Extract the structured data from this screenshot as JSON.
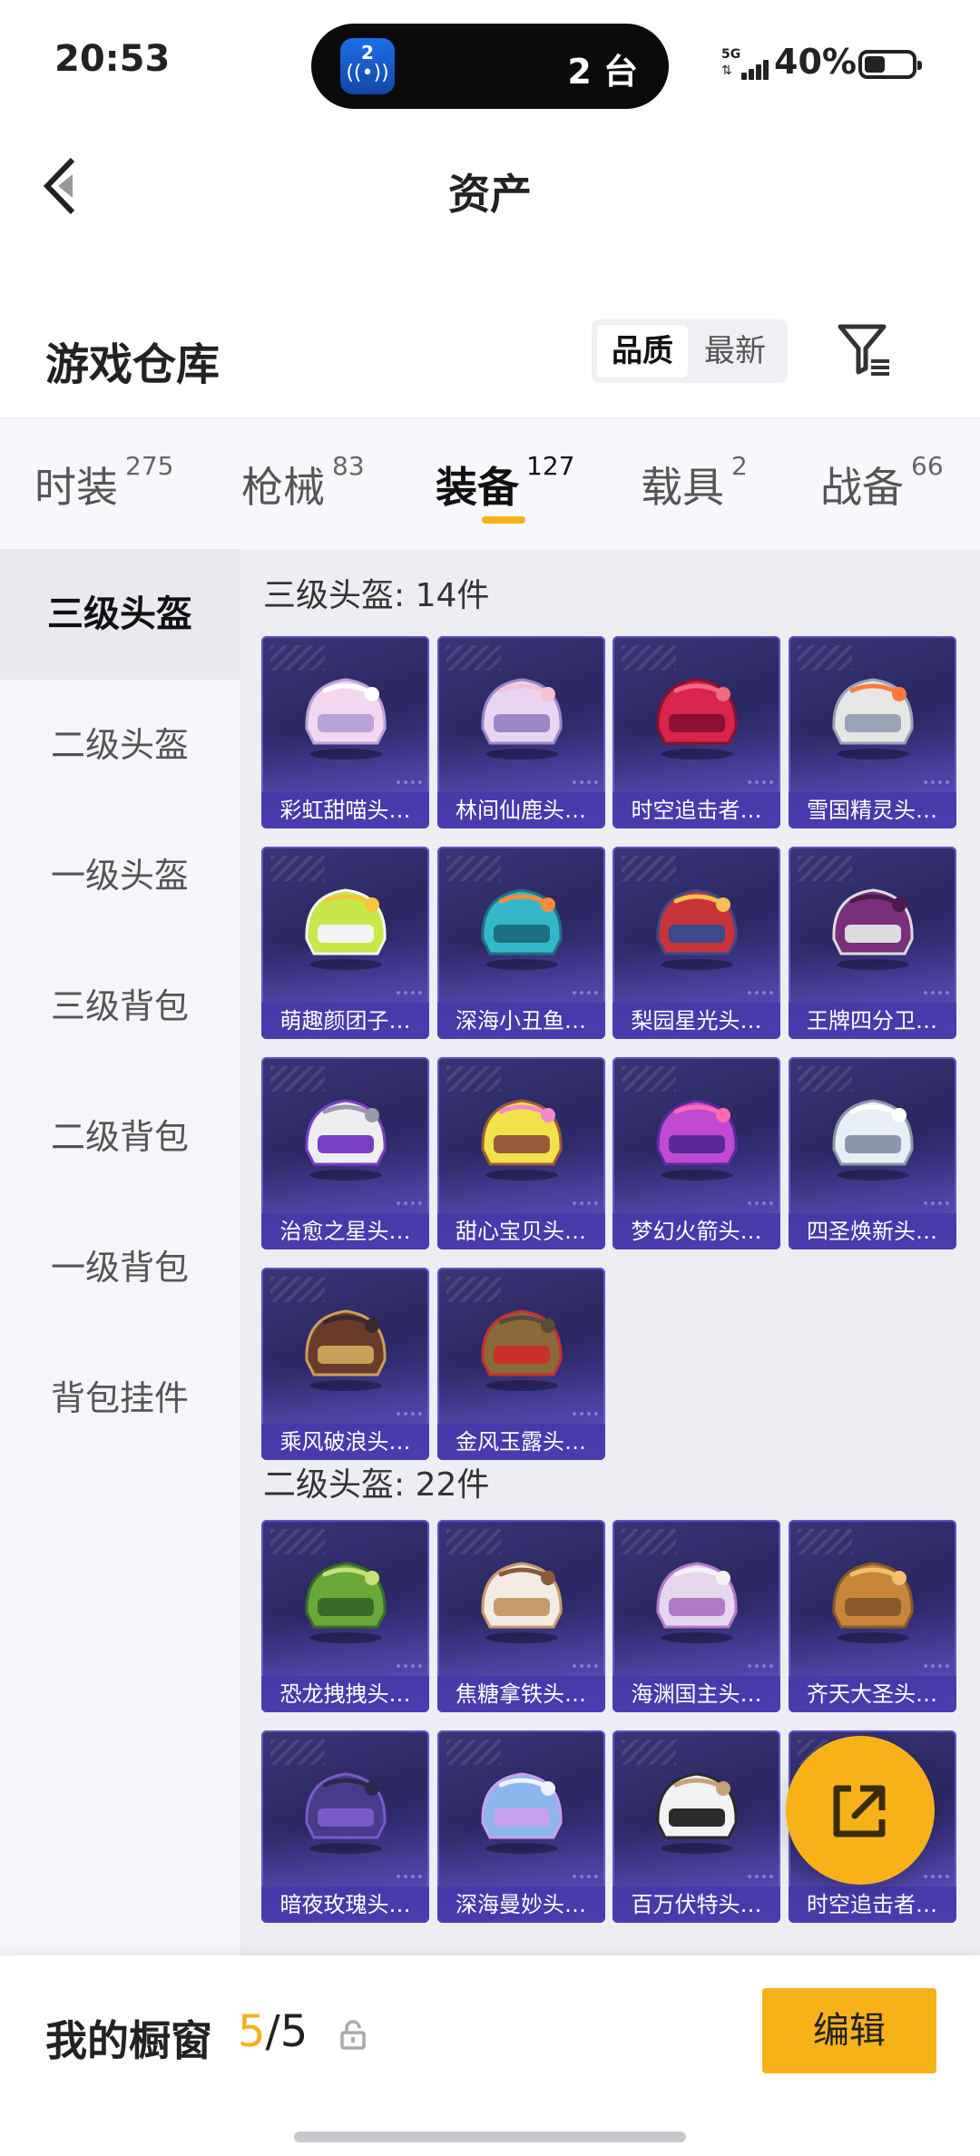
{
  "status_bar": {
    "time": "20:53",
    "island_icon_number": "2",
    "island_icon_glyph": "((•))",
    "island_text": "2 台",
    "network": "5G",
    "battery": "40%"
  },
  "header": {
    "title": "资产"
  },
  "warehouse": {
    "title": "游戏仓库",
    "sort_options": [
      "品质",
      "最新"
    ],
    "sort_active": "品质"
  },
  "tabs": [
    {
      "label": "时装",
      "count": "275"
    },
    {
      "label": "枪械",
      "count": "83"
    },
    {
      "label": "装备",
      "count": "127"
    },
    {
      "label": "载具",
      "count": "2"
    },
    {
      "label": "战备",
      "count": "66"
    }
  ],
  "active_tab": "装备",
  "sidebar": {
    "items": [
      "三级头盔",
      "二级头盔",
      "一级头盔",
      "三级背包",
      "二级背包",
      "一级背包",
      "背包挂件"
    ],
    "active": "三级头盔"
  },
  "sections": [
    {
      "title": "三级头盔: 14件",
      "items": [
        {
          "name": "彩虹甜喵头…",
          "colors": [
            "#f2d7ee",
            "#b9a3d6",
            "#ffffff"
          ]
        },
        {
          "name": "林间仙鹿头…",
          "colors": [
            "#e9d5f0",
            "#9c86c8",
            "#f6c2d2"
          ]
        },
        {
          "name": "时空追击者…",
          "colors": [
            "#d9244b",
            "#8a1230",
            "#f06a84"
          ]
        },
        {
          "name": "雪国精灵头…",
          "colors": [
            "#e6e6e6",
            "#9aa3b5",
            "#ff7a3a"
          ]
        },
        {
          "name": "萌趣颜团子…",
          "colors": [
            "#c8e84a",
            "#f4f4f4",
            "#f7c63a"
          ]
        },
        {
          "name": "深海小丑鱼…",
          "colors": [
            "#34b7c9",
            "#1f6f83",
            "#ff8a3d"
          ]
        },
        {
          "name": "梨园星光头…",
          "colors": [
            "#c8333a",
            "#3a4a8a",
            "#f2c14e"
          ]
        },
        {
          "name": "王牌四分卫…",
          "colors": [
            "#7a2f7a",
            "#dcdcdc",
            "#4a1c4a"
          ]
        },
        {
          "name": "治愈之星头…",
          "colors": [
            "#eeeeee",
            "#7a3ec4",
            "#9a9aa8"
          ]
        },
        {
          "name": "甜心宝贝头…",
          "colors": [
            "#f2e24a",
            "#9a5a3a",
            "#f28ac8"
          ]
        },
        {
          "name": "梦幻火箭头…",
          "colors": [
            "#c04ad2",
            "#5a2a9a",
            "#ff6ab0"
          ]
        },
        {
          "name": "四圣焕新头…",
          "colors": [
            "#e8eef5",
            "#8a97a8",
            "#ffffff"
          ]
        },
        {
          "name": "乘风破浪头…",
          "colors": [
            "#6a3a2a",
            "#c8a05a",
            "#3a2a2a"
          ]
        },
        {
          "name": "金风玉露头…",
          "colors": [
            "#8a6a3a",
            "#c8302a",
            "#5a4a3a"
          ]
        }
      ]
    },
    {
      "title": "二级头盔: 22件",
      "items": [
        {
          "name": "恐龙拽拽头…",
          "colors": [
            "#6aa83a",
            "#3a6a2a",
            "#c8e07a"
          ]
        },
        {
          "name": "焦糖拿铁头…",
          "colors": [
            "#f4ece2",
            "#c89a6a",
            "#8a5a3a"
          ]
        },
        {
          "name": "海渊国主头…",
          "colors": [
            "#e8d5ee",
            "#b07ac8",
            "#f6f0fa"
          ]
        },
        {
          "name": "齐天大圣头…",
          "colors": [
            "#c8863a",
            "#8a5a2a",
            "#f2c06a"
          ]
        },
        {
          "name": "暗夜玫瑰头…",
          "colors": [
            "#4a3a8a",
            "#7a5ac8",
            "#2a2a4a"
          ]
        },
        {
          "name": "深海曼妙头…",
          "colors": [
            "#8ab8ee",
            "#c8a0ee",
            "#f0f4fa"
          ]
        },
        {
          "name": "百万伏特头…",
          "colors": [
            "#f2f2f2",
            "#2a2a2a",
            "#c8a07a"
          ]
        },
        {
          "name": "时空追击者…",
          "colors": [
            "#c8863a",
            "#5a4a8a",
            "#f2c06a"
          ]
        }
      ]
    }
  ],
  "showcase": {
    "label": "我的橱窗",
    "current": "5",
    "total": "/5",
    "edit_label": "编辑"
  },
  "colors": {
    "accent": "#f7b21a",
    "card_bg": "#2b2762"
  }
}
